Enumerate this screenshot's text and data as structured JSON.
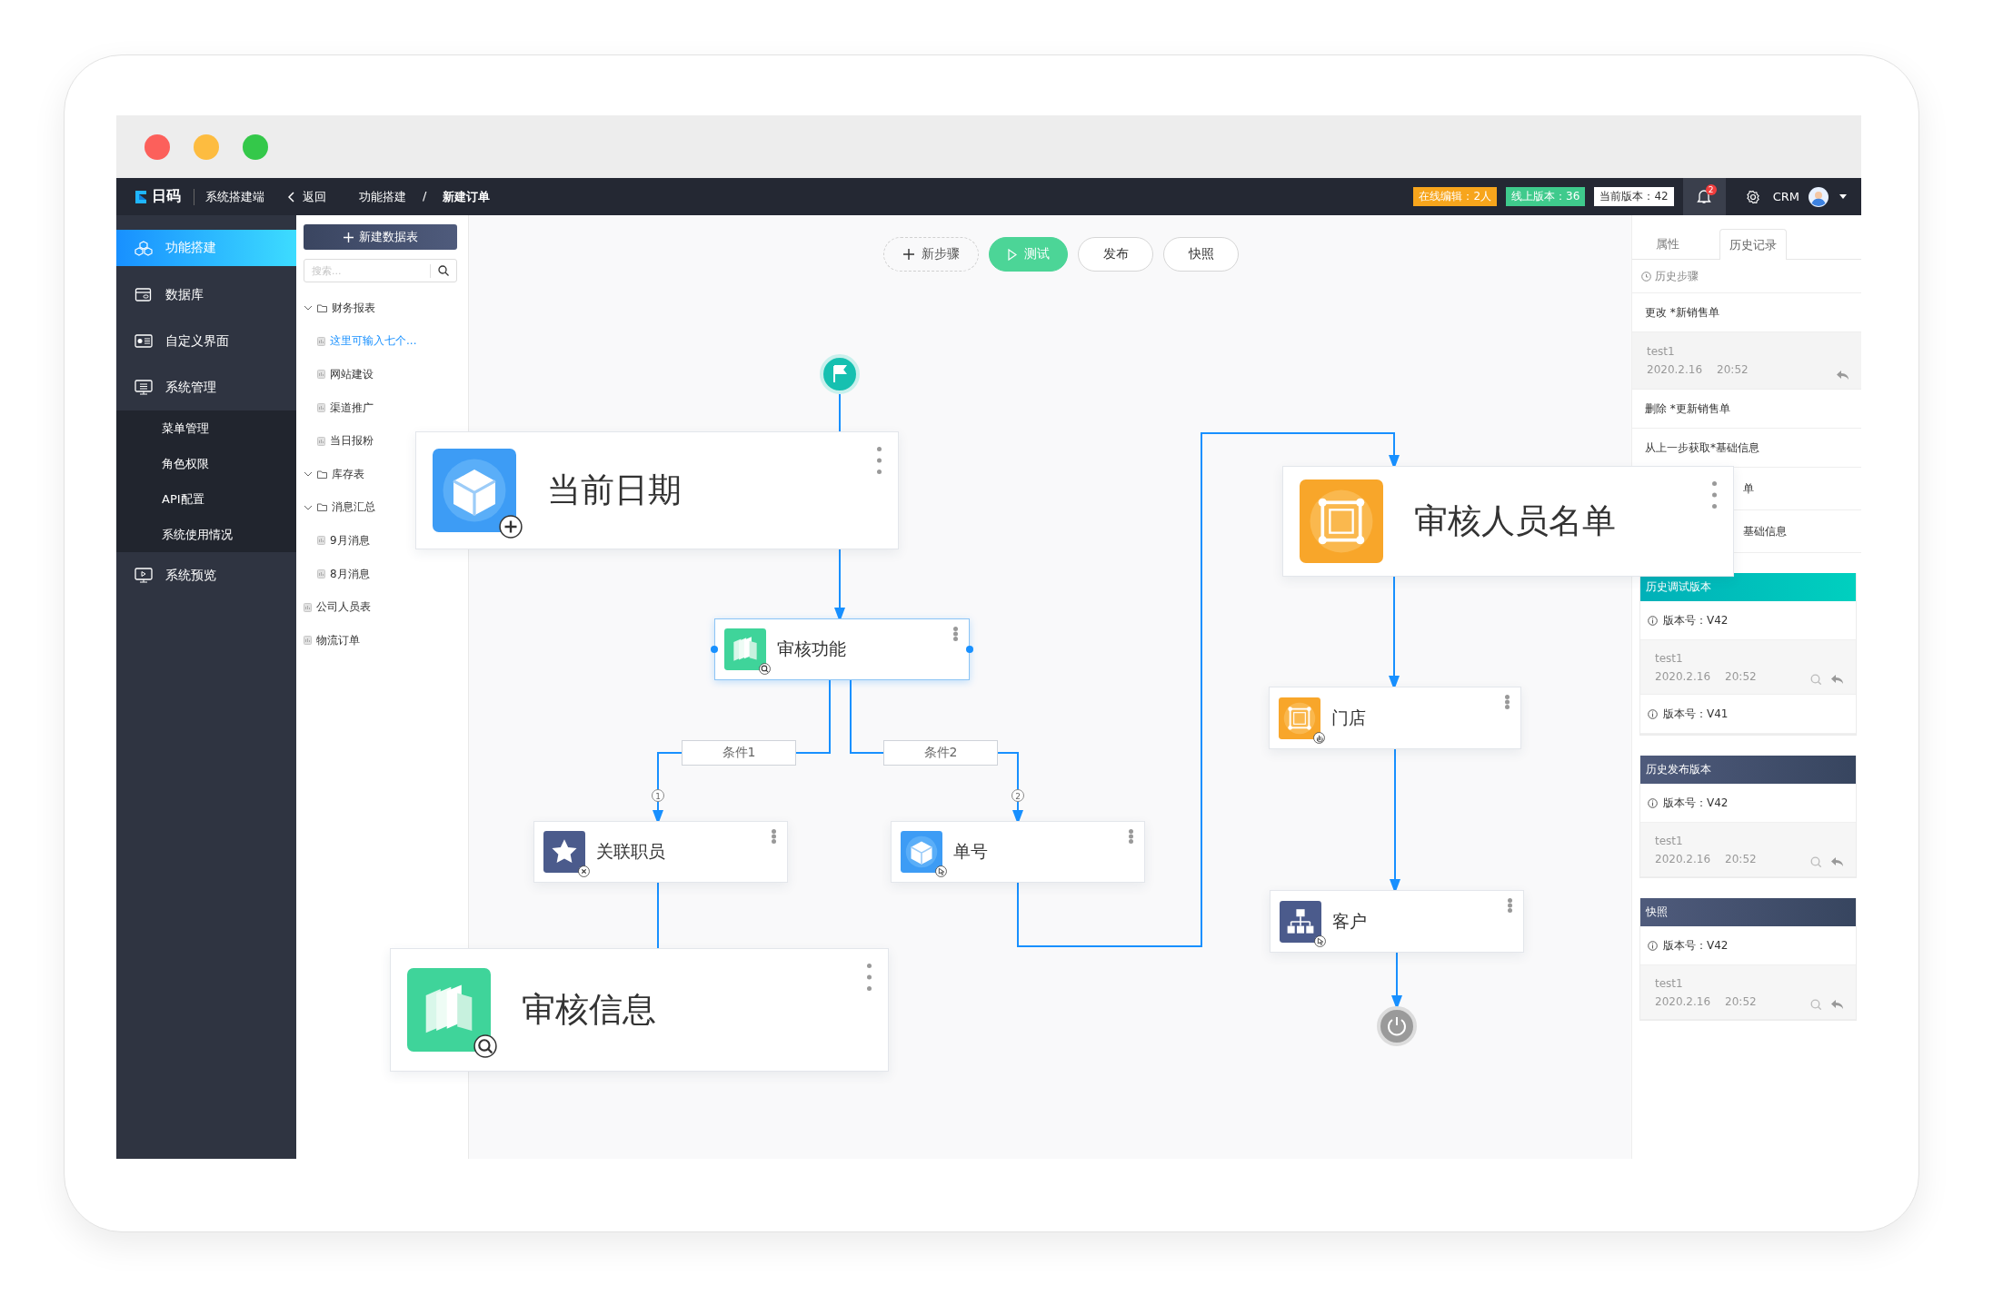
{
  "header": {
    "logo": "日码",
    "app_name": "系统搭建端",
    "back": "返回",
    "breadcrumb": [
      "功能搭建",
      "新建订单"
    ],
    "separator": "/",
    "badges": [
      {
        "text": "在线编辑：2人",
        "color": "#f7a51c"
      },
      {
        "text": "线上版本：36",
        "color": "#3fca8c"
      },
      {
        "text": "当前版本：42",
        "color": "#ffffff"
      }
    ],
    "notification_count": "2",
    "user": "CRM"
  },
  "sidebar": {
    "items": [
      {
        "label": "功能搭建",
        "selected": true
      },
      {
        "label": "数据库",
        "selected": false
      },
      {
        "label": "自定义界面",
        "selected": false
      },
      {
        "label": "系统管理",
        "selected": false,
        "children": [
          {
            "label": "菜单管理",
            "selected": false
          },
          {
            "label": "角色权限",
            "selected": false
          },
          {
            "label": "API配置",
            "selected": false
          },
          {
            "label": "系统使用情况",
            "selected": false
          }
        ]
      },
      {
        "label": "系统预览",
        "selected": false
      }
    ]
  },
  "tree_panel": {
    "new_button": "新建数据表",
    "search": {
      "placeholder": "搜索..."
    },
    "items": [
      {
        "label": "财务报表",
        "kind": "folder",
        "expanded": true,
        "selected": false,
        "children": [
          {
            "label": "这里可输入七个...",
            "kind": "table",
            "selected": true
          },
          {
            "label": "网站建设",
            "kind": "table",
            "selected": false
          },
          {
            "label": "渠道推广",
            "kind": "table",
            "selected": false
          },
          {
            "label": "当日报粉",
            "kind": "table",
            "selected": false
          }
        ]
      },
      {
        "label": "库存表",
        "kind": "folder",
        "expanded": true,
        "selected": false
      },
      {
        "label": "消息汇总",
        "kind": "folder",
        "expanded": true,
        "selected": false,
        "children": [
          {
            "label": "9月消息",
            "kind": "table",
            "selected": false
          },
          {
            "label": "8月消息",
            "kind": "table",
            "selected": false
          }
        ]
      },
      {
        "label": "公司人员表",
        "kind": "table",
        "selected": false
      },
      {
        "label": "物流订单",
        "kind": "table",
        "selected": false
      }
    ]
  },
  "toolbar": {
    "buttons": [
      {
        "label": "新步骤",
        "kind": "add"
      },
      {
        "label": "测试",
        "kind": "run"
      },
      {
        "label": "发布",
        "kind": "plain"
      },
      {
        "label": "快照",
        "kind": "plain"
      }
    ]
  },
  "flow": {
    "nodes": [
      {
        "title": "当前日期",
        "selected": false
      },
      {
        "title": "审核功能",
        "selected": true
      },
      {
        "title": "关联职员",
        "selected": false
      },
      {
        "title": "单号",
        "selected": false
      },
      {
        "title": "审核信息",
        "selected": false
      },
      {
        "title": "审核人员名单",
        "selected": false
      },
      {
        "title": "门店",
        "selected": false
      },
      {
        "title": "客户",
        "selected": false
      }
    ],
    "conditions": [
      "条件1",
      "条件2"
    ],
    "markers": [
      "1",
      "2"
    ]
  },
  "right_panel": {
    "tabs": [
      {
        "label": "属性",
        "selected": false
      },
      {
        "label": "历史记录",
        "selected": true
      }
    ],
    "history": {
      "title": "历史步骤",
      "items": [
        {
          "kind": "action",
          "text": "更改 *新销售单"
        },
        {
          "kind": "detail",
          "user": "test1",
          "date": "2020.2.16",
          "time": "20:52"
        },
        {
          "kind": "action",
          "text": "删除 *更新销售单"
        },
        {
          "kind": "action",
          "text": "从上一步获取*基础信息"
        },
        {
          "kind": "covered",
          "text": "单"
        },
        {
          "kind": "covered",
          "text": "基础信息"
        }
      ]
    },
    "sections": [
      {
        "title": "历史调试版本",
        "kind": "debug",
        "versions": [
          {
            "label": "版本号：V42",
            "expanded": true,
            "user": "test1",
            "date": "2020.2.16",
            "time": "20:52"
          },
          {
            "label": "版本号：V41",
            "expanded": false
          }
        ]
      },
      {
        "title": "历史发布版本",
        "kind": "release",
        "versions": [
          {
            "label": "版本号：V42",
            "expanded": true,
            "user": "test1",
            "date": "2020.2.16",
            "time": "20:52"
          }
        ]
      },
      {
        "title": "快照",
        "kind": "snapshot",
        "versions": [
          {
            "label": "版本号：V42",
            "expanded": true,
            "user": "test1",
            "date": "2020.2.16",
            "time": "20:52"
          }
        ]
      }
    ]
  }
}
